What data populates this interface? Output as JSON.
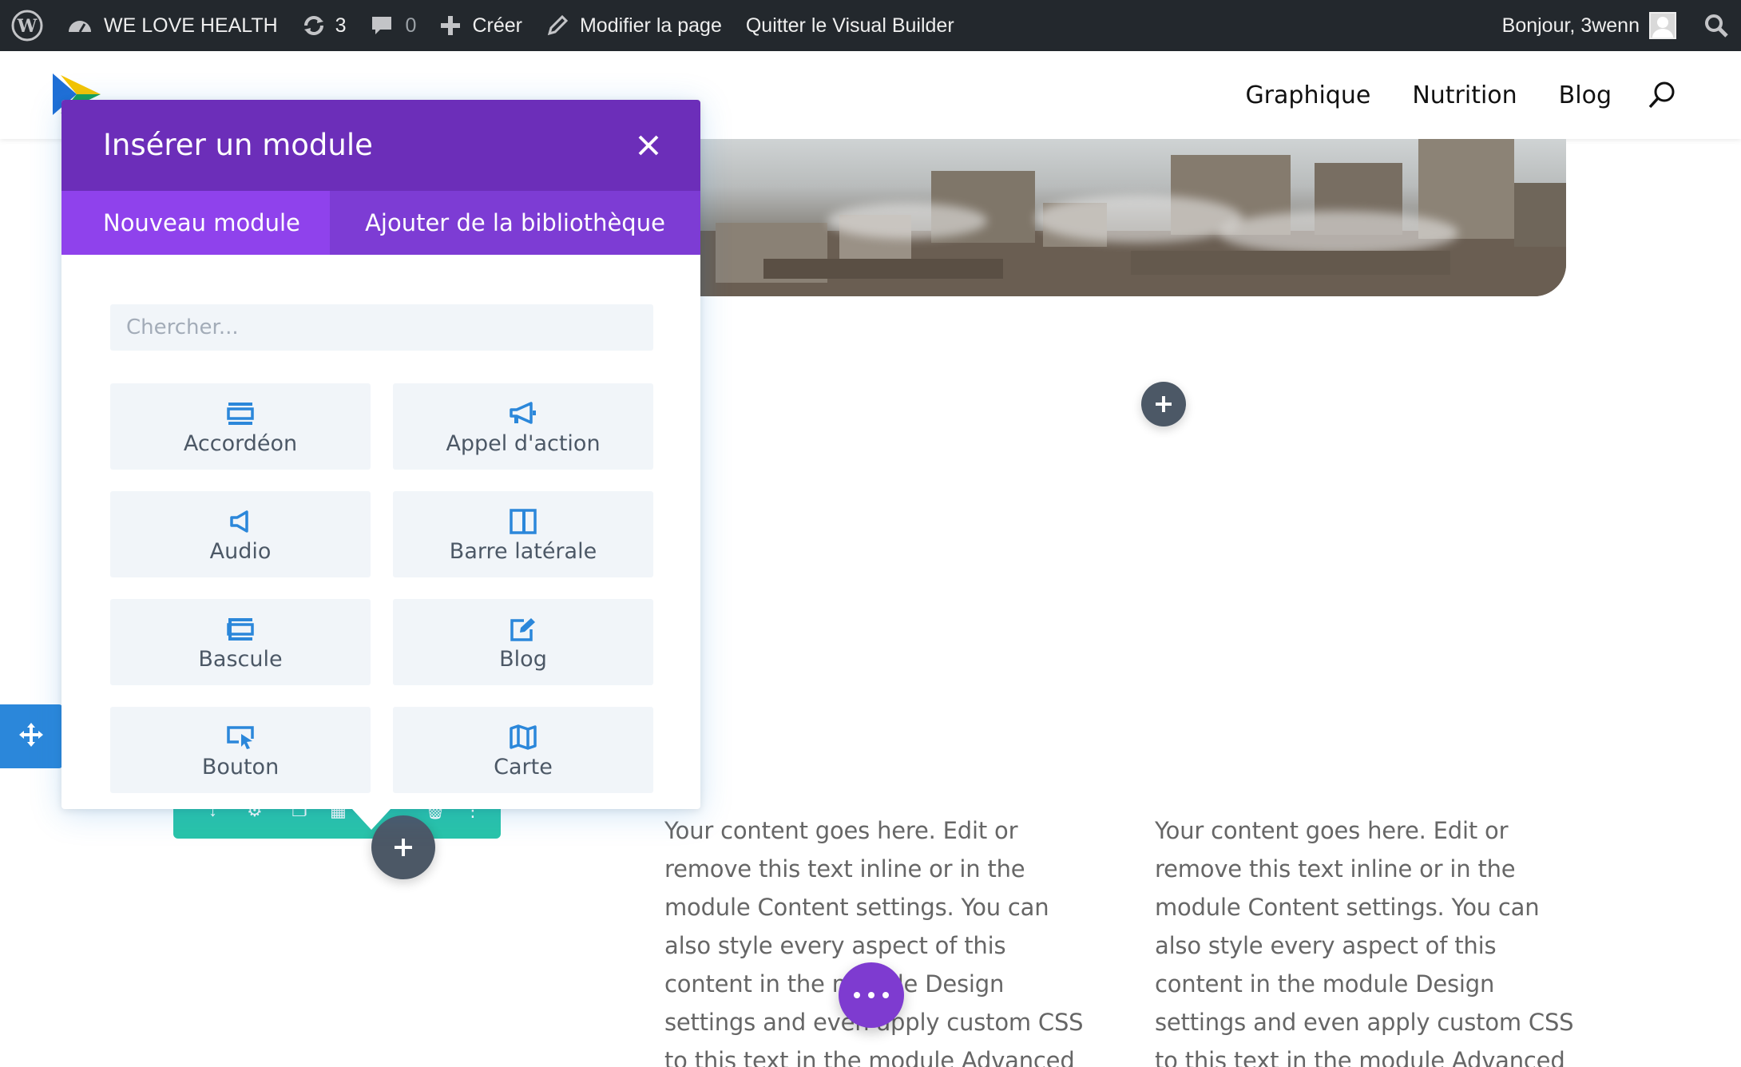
{
  "admin_bar": {
    "site_name": "WE LOVE HEALTH",
    "updates_count": "3",
    "comments_count": "0",
    "new_label": "Créer",
    "edit_label": "Modifier la page",
    "exit_label": "Quitter le Visual Builder",
    "greeting": "Bonjour, 3wenn"
  },
  "site_nav": {
    "items": [
      "Graphique",
      "Nutrition",
      "Blog"
    ]
  },
  "modal": {
    "title": "Insérer un module",
    "tabs": [
      "Nouveau module",
      "Ajouter de la bibliothèque"
    ],
    "search_placeholder": "Chercher...",
    "modules": [
      {
        "label": "Accordéon",
        "icon": "accordion-icon"
      },
      {
        "label": "Appel d'action",
        "icon": "megaphone-icon"
      },
      {
        "label": "Audio",
        "icon": "speaker-icon"
      },
      {
        "label": "Barre latérale",
        "icon": "sidebar-icon"
      },
      {
        "label": "Bascule",
        "icon": "toggle-icon"
      },
      {
        "label": "Blog",
        "icon": "edit-post-icon"
      },
      {
        "label": "Bouton",
        "icon": "cursor-button-icon"
      },
      {
        "label": "Carte",
        "icon": "map-icon"
      }
    ]
  },
  "content": {
    "col1": "Your content goes here. Edit or remove this text inline or in the module Content settings. You can also style every aspect of this content in the module Design settings and even apply custom CSS to this text in the module Advanced settings.",
    "col2": "Your content goes here. Edit or remove this text inline or in the module Content settings. You can also style every aspect of this content in the module Design settings and even apply custom CSS to this text in the module Advanced settings."
  },
  "colors": {
    "admin_bar": "#23282d",
    "modal_header": "#6c2eb9",
    "modal_tabs": "#7d3cd4",
    "active_tab": "#8f42ec",
    "icon_blue": "#2b87da",
    "module_toolbar": "#29c4a9",
    "page_menu": "#7e3bd0"
  }
}
